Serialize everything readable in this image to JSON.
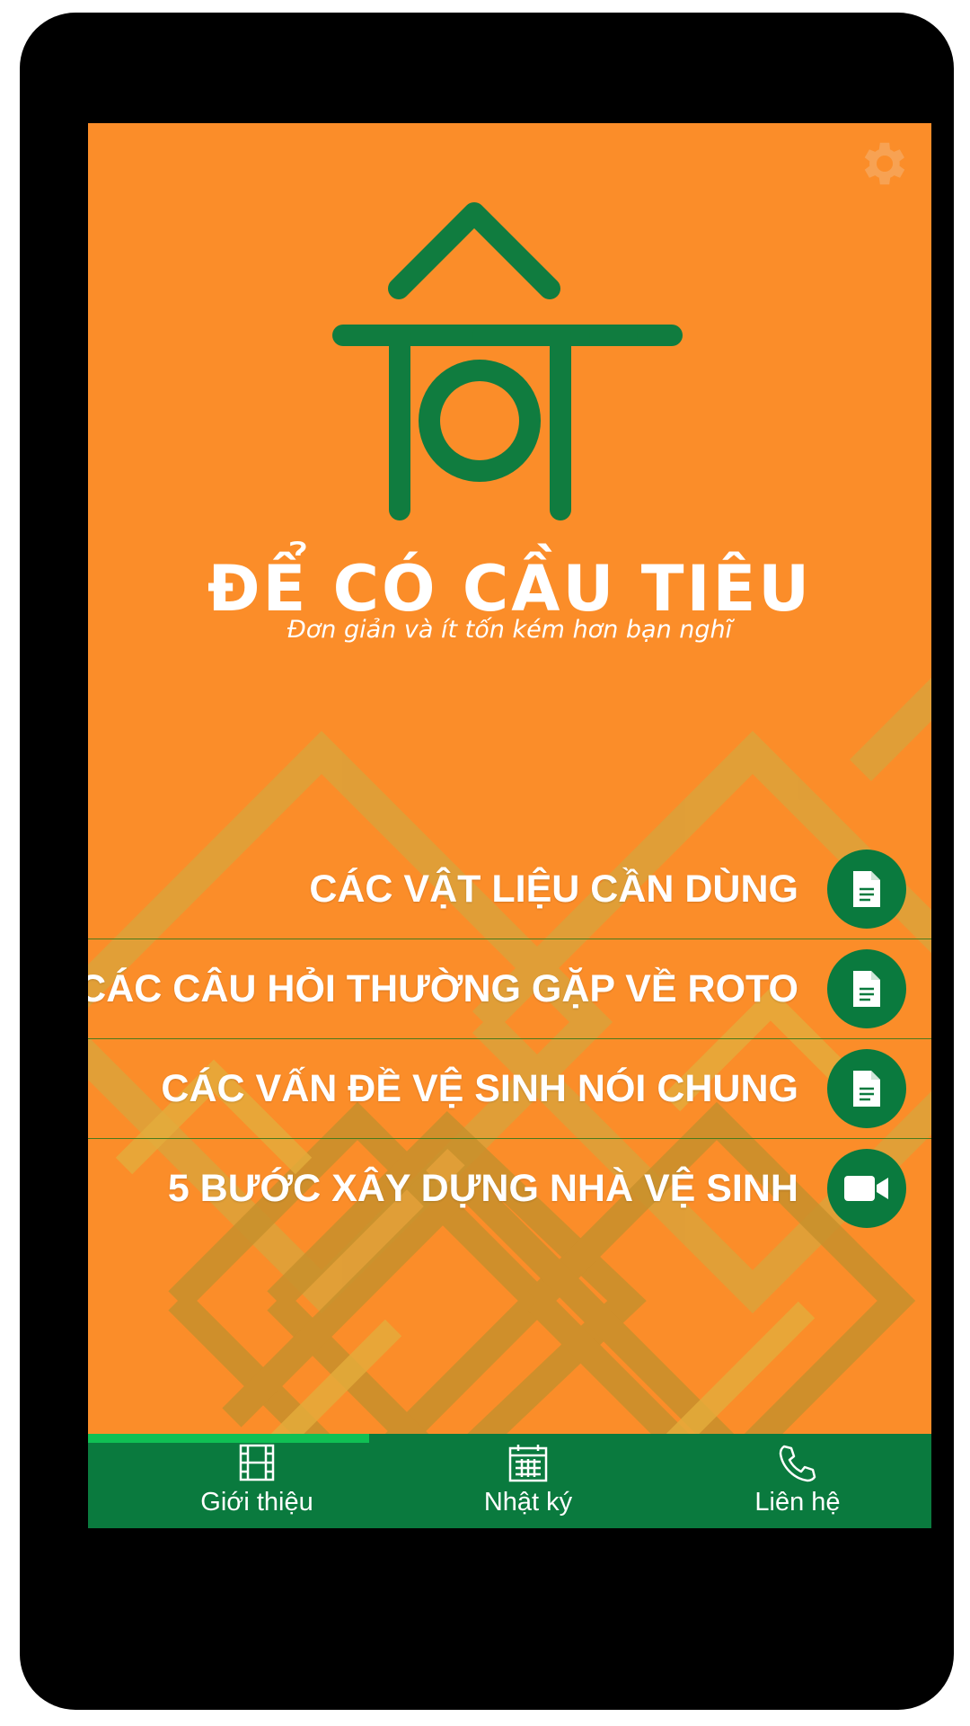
{
  "brand": {
    "logo_text": "TôT",
    "title": "ĐỂ CÓ CẦU TIÊU",
    "subtitle": "Đơn giản và ít tốn kém hơn bạn nghĩ",
    "logo_color": "#107c3f",
    "background_color": "#fb8d29"
  },
  "settings_icon": "gear-icon",
  "menu": {
    "items": [
      {
        "label": "CÁC VẬT LIỆU CẦN DÙNG",
        "icon": "document-icon"
      },
      {
        "label": "CÁC CÂU HỎI THƯỜNG GẶP VỀ ROTO",
        "icon": "document-icon"
      },
      {
        "label": "CÁC VẤN ĐỀ VỆ SINH NÓI CHUNG",
        "icon": "document-icon"
      },
      {
        "label": "5 BƯỚC XÂY DỰNG NHÀ VỆ SINH",
        "icon": "video-icon"
      }
    ]
  },
  "tabs": {
    "items": [
      {
        "label": "Giới thiệu",
        "icon": "film-icon",
        "active": true
      },
      {
        "label": "Nhật ký",
        "icon": "calendar-icon",
        "active": false
      },
      {
        "label": "Liên hệ",
        "icon": "phone-icon",
        "active": false
      }
    ],
    "selected_index": 0,
    "progress_fraction": 0.333
  }
}
